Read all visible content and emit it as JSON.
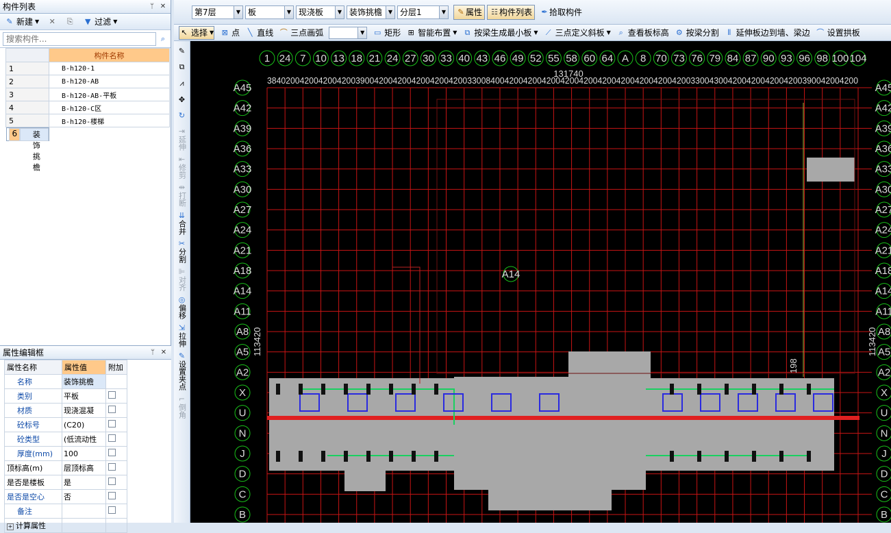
{
  "component_list": {
    "title": "构件列表",
    "new_label": "新建",
    "filter_label": "过滤",
    "search_placeholder": "搜索构件...",
    "column_header": "构件名称",
    "rows": [
      {
        "no": "1",
        "name": "B-h120-1"
      },
      {
        "no": "2",
        "name": "B-h120-AB"
      },
      {
        "no": "3",
        "name": "B-h120-AB-平板"
      },
      {
        "no": "4",
        "name": "B-h120-C区"
      },
      {
        "no": "5",
        "name": "B-h120-楼梯"
      },
      {
        "no": "6",
        "name": "装饰挑檐"
      }
    ],
    "selected_row": "6"
  },
  "property_panel": {
    "title": "属性编辑框",
    "headers": [
      "属性名称",
      "属性值",
      "附加"
    ],
    "rows": [
      {
        "name": "名称",
        "value": "装饰挑檐"
      },
      {
        "name": "类别",
        "value": "平板"
      },
      {
        "name": "材质",
        "value": "现浇混凝"
      },
      {
        "name": "砼标号",
        "value": "(C20)"
      },
      {
        "name": "砼类型",
        "value": "(低流动性"
      },
      {
        "name": "厚度(mm)",
        "value": "100"
      },
      {
        "name": "顶标高(m)",
        "value": "层顶标高"
      },
      {
        "name": "是否是楼板",
        "value": "是"
      },
      {
        "name": "是否是空心",
        "value": "否"
      },
      {
        "name": "备注",
        "value": ""
      },
      {
        "name": "计算属性",
        "value": ""
      }
    ]
  },
  "top_toolbar": {
    "floor": "第7层",
    "type": "板",
    "subtype": "现浇板",
    "component": "装饰挑檐",
    "layer": "分层1",
    "properties_label": "属性",
    "component_list_label": "构件列表",
    "pick_label": "拾取构件"
  },
  "draw_toolbar": {
    "select_label": "选择",
    "point_label": "点",
    "line_label": "直线",
    "arc_label": "三点画弧",
    "rect_label": "矩形",
    "smart_label": "智能布置",
    "beam_gen_label": "按梁生成最小板",
    "slope_label": "三点定义斜板",
    "view_elev_label": "查看板标高",
    "beam_split_label": "按梁分割",
    "extend_label": "延伸板边到墙、梁边",
    "arch_label": "设置拱板"
  },
  "vertical_toolbar": [
    {
      "label": "延伸",
      "enabled": false
    },
    {
      "label": "修剪",
      "enabled": false
    },
    {
      "label": "打断",
      "enabled": false
    },
    {
      "label": "合并",
      "enabled": true
    },
    {
      "label": "分割",
      "enabled": true
    },
    {
      "label": "对齐",
      "enabled": false
    },
    {
      "label": "偏移",
      "enabled": true
    },
    {
      "label": "拉伸",
      "enabled": true
    },
    {
      "label": "设置夹点",
      "enabled": true
    },
    {
      "label": "倒角",
      "enabled": false
    }
  ],
  "canvas": {
    "top_axes": [
      "1",
      "24",
      "7",
      "10",
      "13",
      "18",
      "21",
      "24",
      "27",
      "30",
      "33",
      "40",
      "43",
      "46",
      "49",
      "52",
      "55",
      "58",
      "60",
      "64",
      "A",
      "8",
      "70",
      "73",
      "76",
      "79",
      "84",
      "87",
      "90",
      "93",
      "96",
      "98",
      "100",
      "104"
    ],
    "left_axes": [
      "A45",
      "A42",
      "A39",
      "A36",
      "A33",
      "A30",
      "A27",
      "A24",
      "A21",
      "A18",
      "A14",
      "A11",
      "A8",
      "A5",
      "A2",
      "X",
      "U",
      "N",
      "J",
      "D",
      "C",
      "B"
    ],
    "right_axes": [
      "A45",
      "A42",
      "A39",
      "A36",
      "A33",
      "A30",
      "A27",
      "A24",
      "A21",
      "A18",
      "A14",
      "A11",
      "A8",
      "A5",
      "A2",
      "X",
      "U",
      "N",
      "J",
      "D",
      "C",
      "B"
    ],
    "center_label": "A14",
    "top_dimension": "131740",
    "left_dimension": "113420",
    "right_dimension": "113420",
    "extra_dim": "198",
    "dim_row_text": "3840200420042004200390042004200420042004200330084004200420042004200420042004200420042004200330043004200420042004200390042004200"
  },
  "colors": {
    "grid": "#c81414",
    "axis_circle": "#19c019",
    "slab": "#a8a8a8",
    "selection_accent": "#ffc98a"
  }
}
